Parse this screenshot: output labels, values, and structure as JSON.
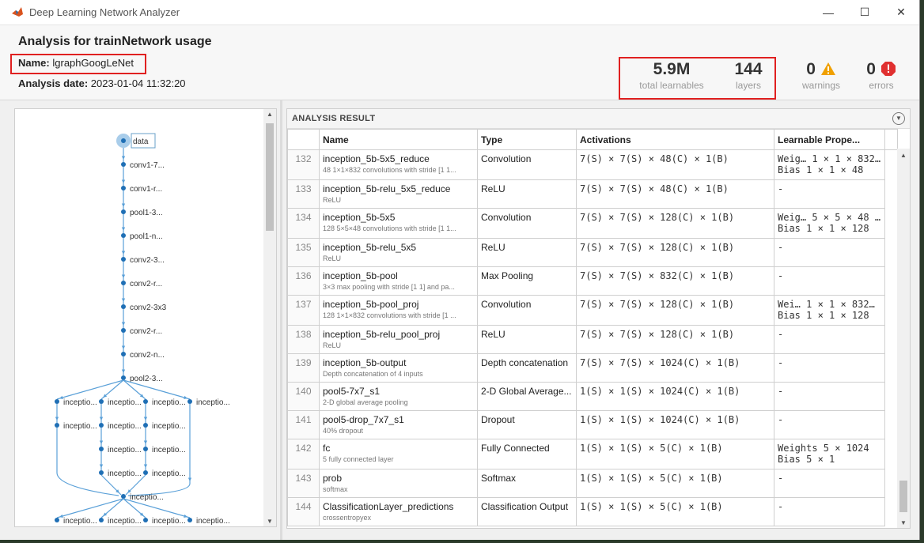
{
  "window": {
    "title": "Deep Learning Network Analyzer",
    "minimize_glyph": "—",
    "maximize_glyph": "☐",
    "close_glyph": "✕"
  },
  "header": {
    "title": "Analysis for trainNetwork usage",
    "name_label": "Name:",
    "name_value": "lgraphGoogLeNet",
    "date_label": "Analysis date:",
    "date_value": "2023-01-04 11:32:20"
  },
  "stats": {
    "learnables_value": "5.9M",
    "learnables_label": "total learnables",
    "layers_value": "144",
    "layers_label": "layers",
    "warnings_value": "0",
    "warnings_label": "warnings",
    "errors_value": "0",
    "errors_label": "errors",
    "warning_color": "#f0a000",
    "error_color": "#e03030"
  },
  "graph": {
    "nodes": [
      "data",
      "conv1-7...",
      "conv1-r...",
      "pool1-3...",
      "pool1-n...",
      "conv2-3...",
      "conv2-r...",
      "conv2-3x3",
      "conv2-r...",
      "conv2-n...",
      "pool2-3..."
    ],
    "branch_row1": [
      "inceptio...",
      "inceptio...",
      "inceptio...",
      "inceptio..."
    ],
    "branch_row2": [
      "inceptio...",
      "inceptio...",
      "inceptio..."
    ],
    "branch_row3": [
      "inceptio...",
      "inceptio..."
    ],
    "branch_row4": [
      "inceptio...",
      "inceptio..."
    ],
    "merge": "inceptio...",
    "branch_row5": [
      "inceptio...",
      "inceptio...",
      "inceptio...",
      "inceptio..."
    ]
  },
  "analysis": {
    "title": "ANALYSIS RESULT",
    "columns": [
      "Name",
      "Type",
      "Activations",
      "Learnable Prope..."
    ],
    "rows": [
      {
        "idx": "132",
        "name": "inception_5b-5x5_reduce",
        "desc": "48 1×1×832 convolutions with stride [1 1...",
        "type": "Convolution",
        "act": "7(S) × 7(S) × 48(C) × 1(B)",
        "learn1": "Weig… 1 × 1 × 832…",
        "learn2": "Bias  1 × 1 × 48"
      },
      {
        "idx": "133",
        "name": "inception_5b-relu_5x5_reduce",
        "desc": "ReLU",
        "type": "ReLU",
        "act": "7(S) × 7(S) × 48(C) × 1(B)",
        "learn1": "-",
        "learn2": ""
      },
      {
        "idx": "134",
        "name": "inception_5b-5x5",
        "desc": "128 5×5×48 convolutions with stride [1 1...",
        "type": "Convolution",
        "act": "7(S) × 7(S) × 128(C) × 1(B)",
        "learn1": "Weig… 5 × 5 × 48 …",
        "learn2": "Bias  1 × 1 × 128"
      },
      {
        "idx": "135",
        "name": "inception_5b-relu_5x5",
        "desc": "ReLU",
        "type": "ReLU",
        "act": "7(S) × 7(S) × 128(C) × 1(B)",
        "learn1": "-",
        "learn2": ""
      },
      {
        "idx": "136",
        "name": "inception_5b-pool",
        "desc": "3×3 max pooling with stride [1 1] and pa...",
        "type": "Max Pooling",
        "act": "7(S) × 7(S) × 832(C) × 1(B)",
        "learn1": "-",
        "learn2": ""
      },
      {
        "idx": "137",
        "name": "inception_5b-pool_proj",
        "desc": "128 1×1×832 convolutions with stride [1 ...",
        "type": "Convolution",
        "act": "7(S) × 7(S) × 128(C) × 1(B)",
        "learn1": "Wei…  1 × 1 × 832…",
        "learn2": "Bias  1 × 1 × 128"
      },
      {
        "idx": "138",
        "name": "inception_5b-relu_pool_proj",
        "desc": "ReLU",
        "type": "ReLU",
        "act": "7(S) × 7(S) × 128(C) × 1(B)",
        "learn1": "-",
        "learn2": ""
      },
      {
        "idx": "139",
        "name": "inception_5b-output",
        "desc": "Depth concatenation of 4 inputs",
        "type": "Depth concatenation",
        "act": "7(S) × 7(S) × 1024(C) × 1(B)",
        "learn1": "-",
        "learn2": ""
      },
      {
        "idx": "140",
        "name": "pool5-7x7_s1",
        "desc": "2-D global average pooling",
        "type": "2-D Global Average...",
        "act": "1(S) × 1(S) × 1024(C) × 1(B)",
        "learn1": "-",
        "learn2": ""
      },
      {
        "idx": "141",
        "name": "pool5-drop_7x7_s1",
        "desc": "40% dropout",
        "type": "Dropout",
        "act": "1(S) × 1(S) × 1024(C) × 1(B)",
        "learn1": "-",
        "learn2": ""
      },
      {
        "idx": "142",
        "name": "fc",
        "desc": "5 fully connected layer",
        "type": "Fully Connected",
        "act": "1(S) × 1(S) × 5(C) × 1(B)",
        "learn1": "Weights  5 × 1024",
        "learn2": "Bias     5 × 1"
      },
      {
        "idx": "143",
        "name": "prob",
        "desc": "softmax",
        "type": "Softmax",
        "act": "1(S) × 1(S) × 5(C) × 1(B)",
        "learn1": "-",
        "learn2": ""
      },
      {
        "idx": "144",
        "name": "ClassificationLayer_predictions",
        "desc": "crossentropyex",
        "type": "Classification Output",
        "act": "1(S) × 1(S) × 5(C) × 1(B)",
        "learn1": "-",
        "learn2": ""
      }
    ]
  }
}
